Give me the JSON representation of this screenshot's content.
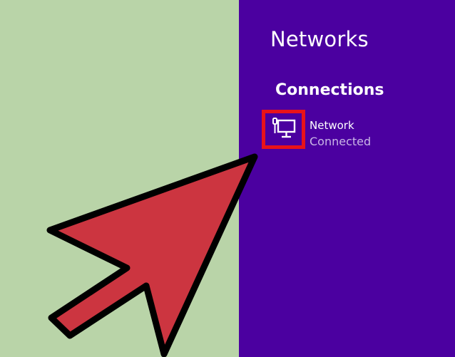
{
  "panel": {
    "title": "Networks",
    "section_heading": "Connections",
    "network": {
      "name": "Network",
      "status": "Connected",
      "icon": "wired-network-icon"
    }
  },
  "annotation": {
    "arrow_icon": "pointer-arrow-icon",
    "highlight_color": "#e8131a",
    "arrow_color": "#cc3540"
  },
  "colors": {
    "panel_background": "#4b00a0",
    "left_background": "#b9d4a8",
    "status_text": "#c9b6e6"
  }
}
